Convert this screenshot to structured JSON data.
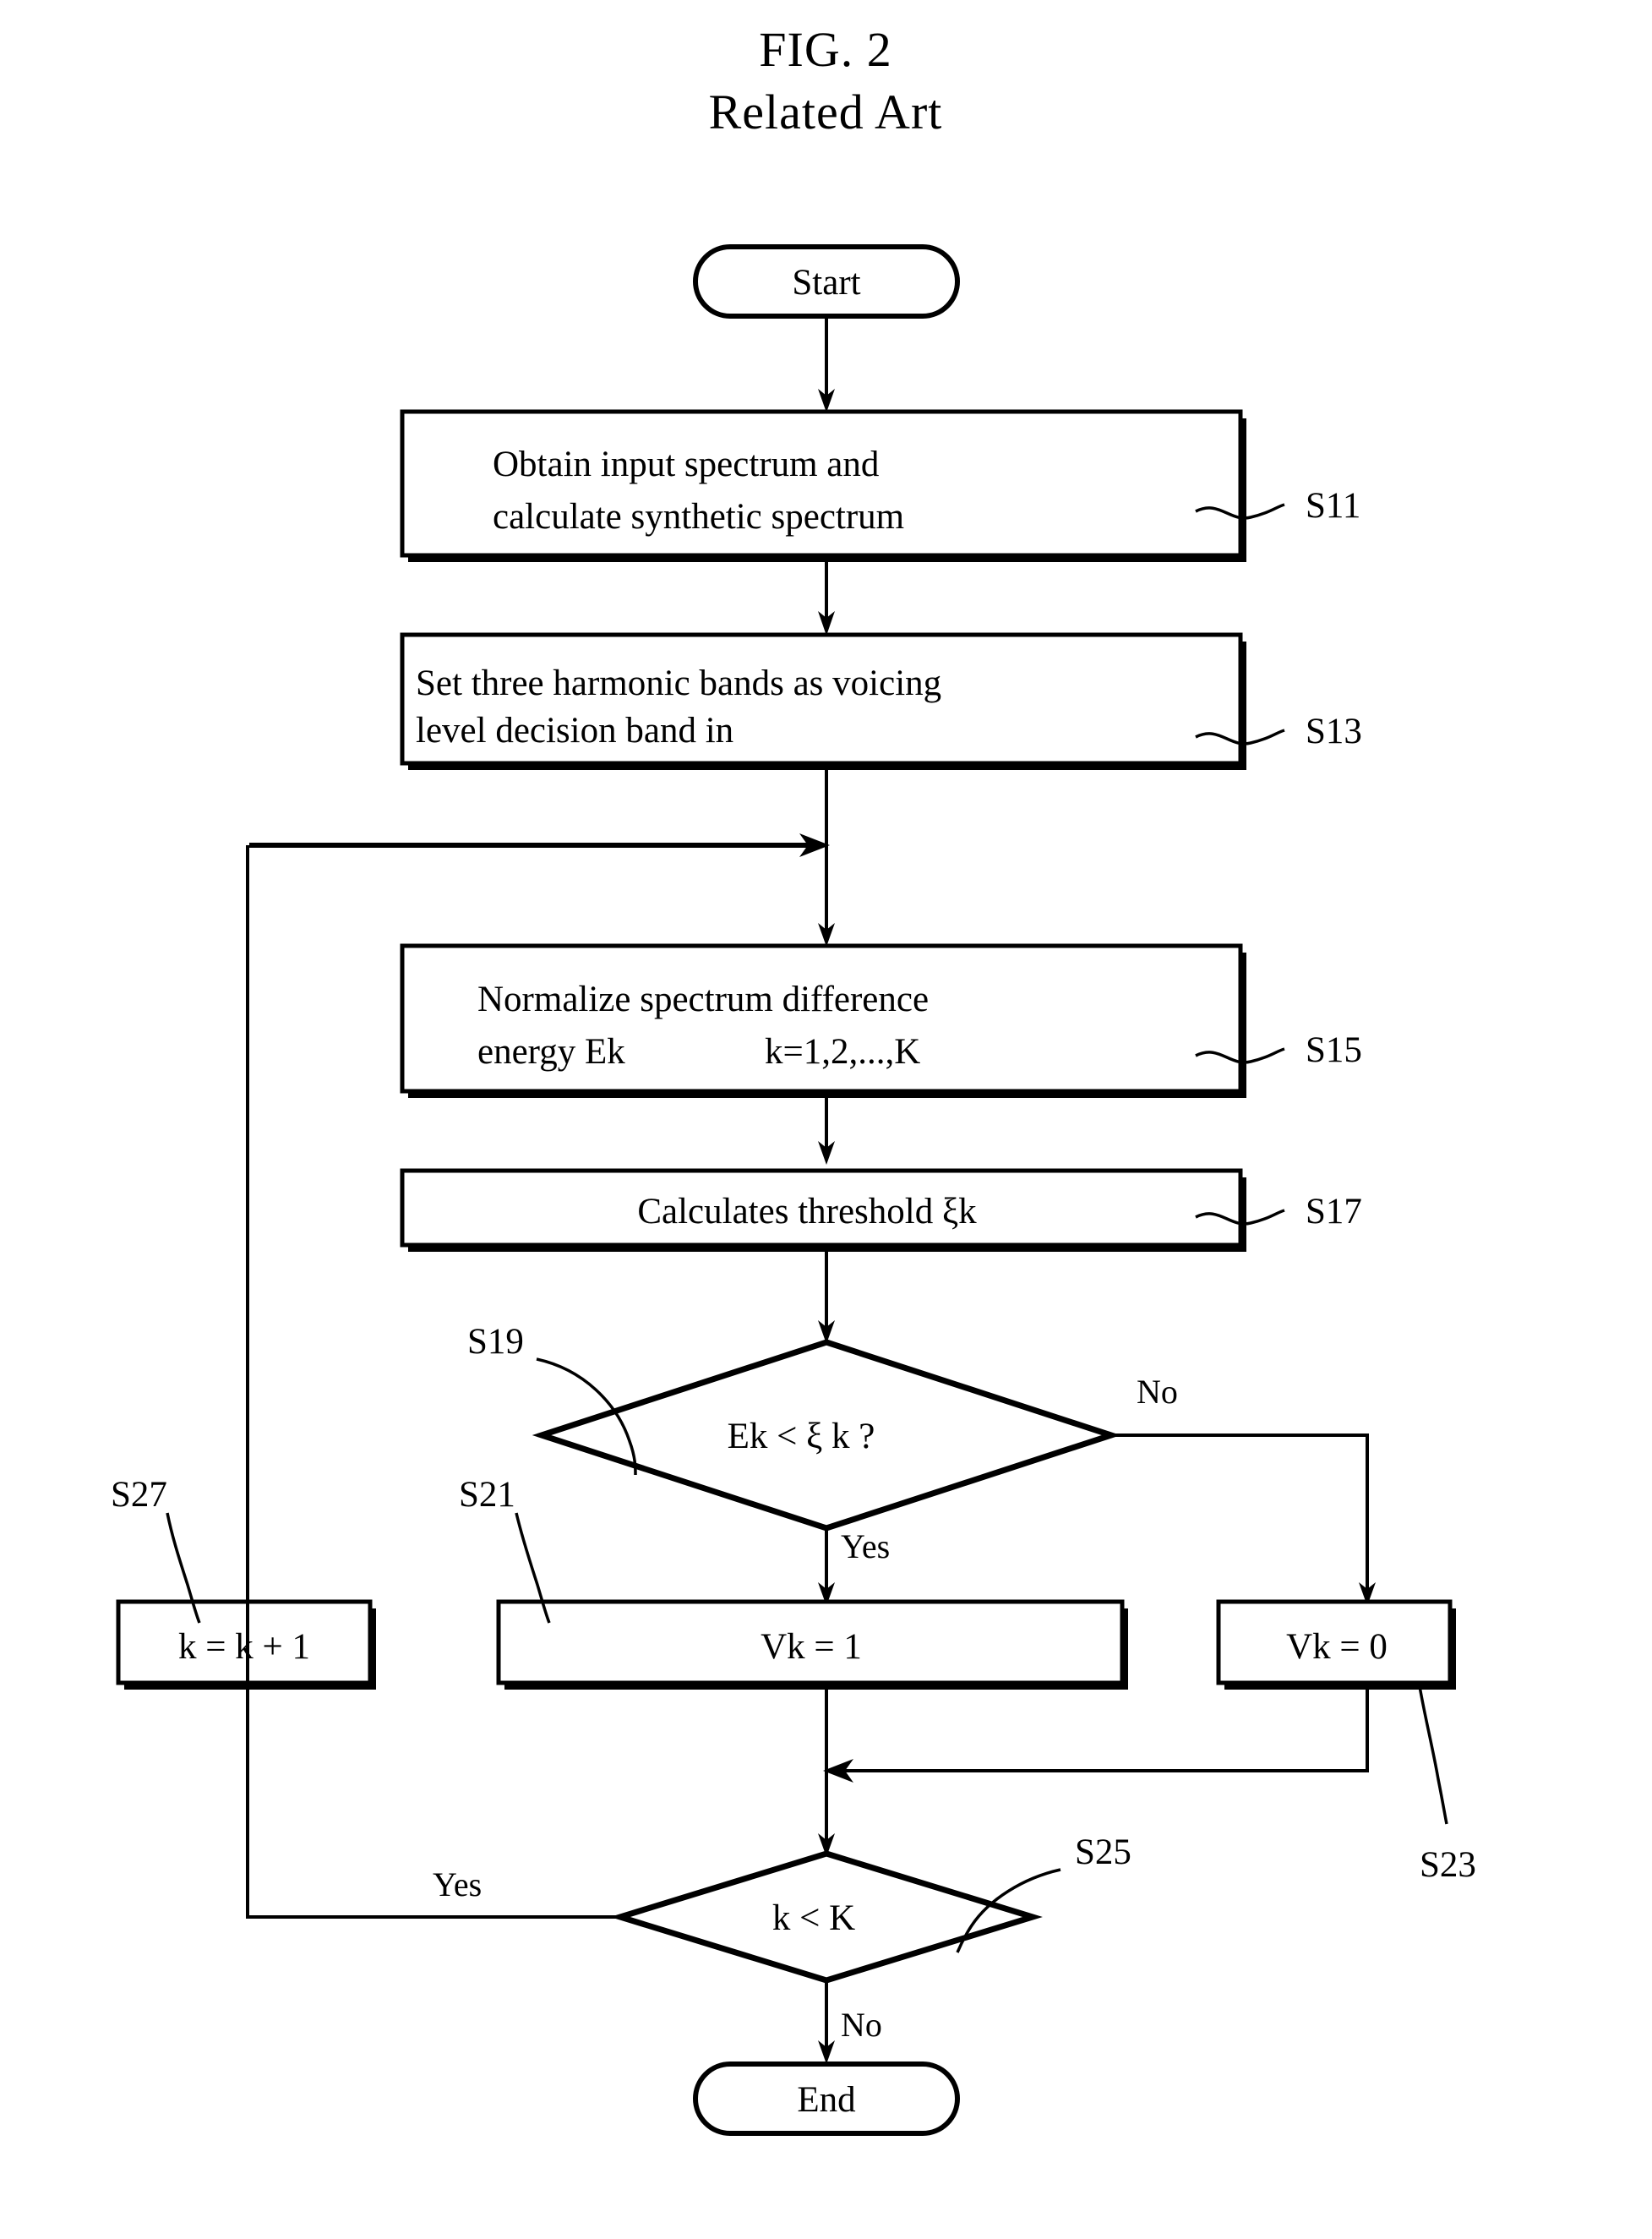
{
  "figure": {
    "title_line1": "FIG. 2",
    "title_line2": "Related Art"
  },
  "nodes": {
    "start": {
      "label": "Start",
      "type": "terminal"
    },
    "s11": {
      "ref": "S11",
      "type": "process",
      "line1": "Obtain input spectrum and",
      "line2": "calculate synthetic spectrum"
    },
    "s13": {
      "ref": "S13",
      "type": "process",
      "line1": "Set three harmonic bands as voicing",
      "line2": "level decision band in"
    },
    "s15": {
      "ref": "S15",
      "type": "process",
      "line1": "Normalize spectrum difference",
      "line2a": "energy Ek",
      "line2b": "k=1,2,...,K"
    },
    "s17": {
      "ref": "S17",
      "type": "process",
      "line1": "Calculates threshold ξk"
    },
    "s19": {
      "ref": "S19",
      "type": "decision",
      "label": "Ek < ξ k ?"
    },
    "s21": {
      "ref": "S21",
      "type": "process",
      "label": "Vk = 1"
    },
    "s23": {
      "ref": "S23",
      "type": "process",
      "label": "Vk = 0"
    },
    "s25": {
      "ref": "S25",
      "type": "decision",
      "label": "k < K"
    },
    "s27": {
      "ref": "S27",
      "type": "process",
      "label": "k = k + 1"
    },
    "end": {
      "label": "End",
      "type": "terminal"
    }
  },
  "edge_labels": {
    "s19_no": "No",
    "s19_yes": "Yes",
    "s25_yes": "Yes",
    "s25_no": "No"
  },
  "colors": {
    "ink": "#000000",
    "paper": "#ffffff"
  }
}
